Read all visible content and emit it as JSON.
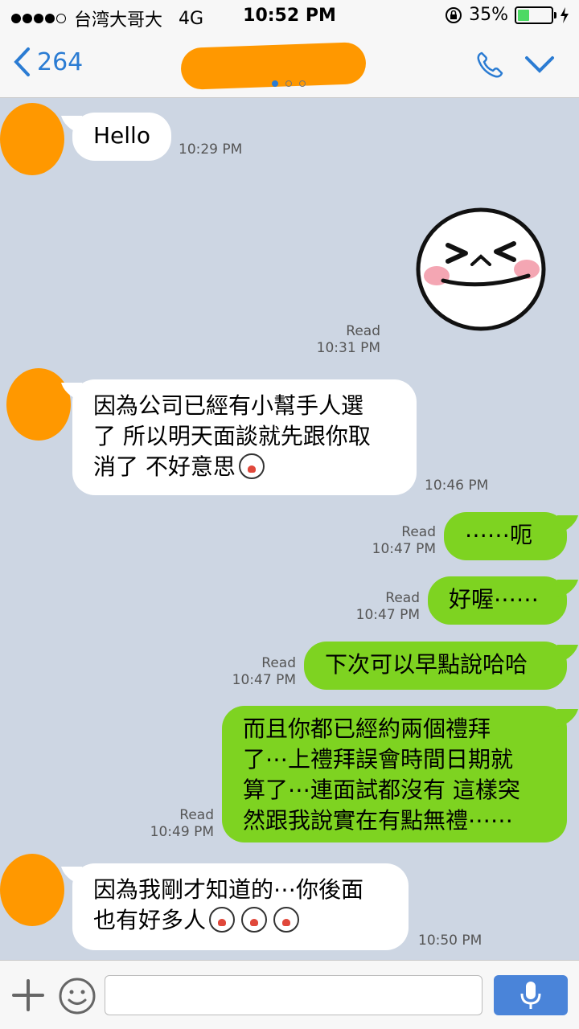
{
  "status_bar": {
    "carrier": "台湾大哥大",
    "network": "4G",
    "time": "10:52 PM",
    "battery_percent": "35%",
    "battery_level": 0.35
  },
  "nav": {
    "back_count": "264",
    "contact_name_redacted": true,
    "pager_pages": 3,
    "pager_active": 1
  },
  "messages": [
    {
      "direction": "in",
      "text": "Hello",
      "time": "10:29 PM"
    },
    {
      "direction": "out",
      "type": "sticker",
      "sticker": "laughing-face",
      "read": "Read",
      "time": "10:31 PM"
    },
    {
      "direction": "in",
      "lines": [
        "因為公司已經有小幫手人選",
        "了 所以明天面談就先跟你取",
        "消了 不好意思"
      ],
      "emoji_count": 1,
      "time": "10:46 PM"
    },
    {
      "direction": "out",
      "text": "⋯⋯呃",
      "read": "Read",
      "time": "10:47 PM"
    },
    {
      "direction": "out",
      "text": "好喔⋯⋯",
      "read": "Read",
      "time": "10:47 PM"
    },
    {
      "direction": "out",
      "text": "下次可以早點說哈哈",
      "read": "Read",
      "time": "10:47 PM"
    },
    {
      "direction": "out",
      "lines": [
        "而且你都已經約兩個禮拜",
        "了⋯上禮拜誤會時間日期就",
        "算了⋯連面試都沒有 這樣突",
        "然跟我說實在有點無禮⋯⋯"
      ],
      "read": "Read",
      "time": "10:49 PM"
    },
    {
      "direction": "in",
      "lines": [
        "因為我剛才知道的⋯你後面",
        "也有好多人"
      ],
      "emoji_count": 3,
      "time": "10:50 PM"
    }
  ],
  "input": {
    "placeholder": "",
    "value": ""
  },
  "colors": {
    "chat_bg": "#cdd6e3",
    "outgoing_bubble": "#7ed321",
    "incoming_bubble": "#ffffff",
    "accent": "#2b7cd3",
    "mic_button": "#4a84d9",
    "avatar_redaction": "#ff9800"
  },
  "icons": [
    "back-chevron-icon",
    "phone-icon",
    "chevron-down-icon",
    "plus-icon",
    "smiley-icon",
    "microphone-icon",
    "crying-emoji-icon",
    "lock-rotation-icon",
    "charging-bolt-icon"
  ]
}
